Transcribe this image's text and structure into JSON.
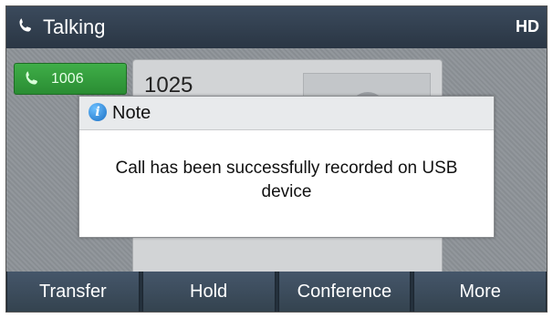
{
  "status": {
    "title": "Talking",
    "quality_badge": "HD"
  },
  "line_key": {
    "label": "1006",
    "color": "#2f9a39"
  },
  "call": {
    "number": "1025"
  },
  "dialog": {
    "title": "Note",
    "message": "Call has been successfully recorded on USB device"
  },
  "softkeys": [
    {
      "label": "Transfer"
    },
    {
      "label": "Hold"
    },
    {
      "label": "Conference"
    },
    {
      "label": "More"
    }
  ],
  "colors": {
    "titlebar": "#2f3b4a",
    "softkey": "#3e4e60",
    "accent_green": "#2f9a39"
  },
  "icons": {
    "title_icon": "phone-handset-icon",
    "line_key_icon": "phone-handset-icon",
    "dialog_icon": "info-icon"
  }
}
